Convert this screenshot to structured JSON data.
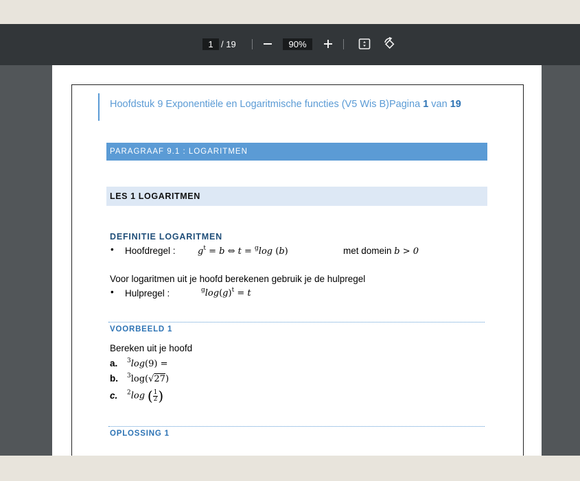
{
  "toolbar": {
    "current_page": "1",
    "total_pages": "/ 19",
    "zoom": "90%",
    "icons": [
      "minus-icon",
      "plus-icon",
      "fit-page-icon",
      "rotate-icon"
    ]
  },
  "document": {
    "header": {
      "title": "Hoofdstuk 9 Exponentiële en Logaritmische functies (V5 Wis B)Pagina ",
      "page_num": "1",
      "van": " van ",
      "page_total": "19"
    },
    "paragraaf": "PARAGRAAF 9.1 : LOGARITMEN",
    "les": "LES 1 LOGARITMEN",
    "definitie": {
      "heading": "DEFINITIE LOGARITMEN",
      "hoofdregel_label": "Hoofdregel :",
      "hoofdregel_formula": "g",
      "hoofdregel_domain_text": "met domein ",
      "hoofdregel_domain_math": "b > 0",
      "intro": "Voor logaritmen uit je hoofd berekenen gebruik je de hulpregel",
      "hulpregel_label": "Hulpregel :"
    },
    "voorbeeld": {
      "heading": "VOORBEELD 1",
      "intro": "Bereken uit je hoofd",
      "a_label": "a.",
      "b_label": "b.",
      "c_label": "c."
    },
    "oplossing": {
      "heading": "OPLOSSING 1"
    }
  }
}
